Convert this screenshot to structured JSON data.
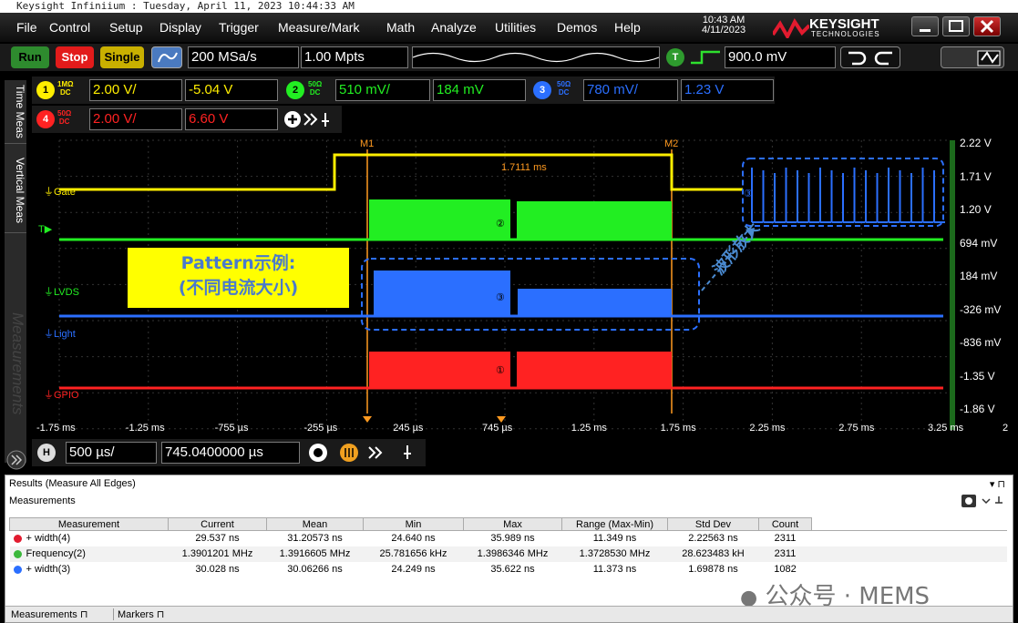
{
  "titlebar": "Keysight Infiniium : Tuesday, April 11, 2023 10:44:33 AM",
  "menu": [
    "File",
    "Control",
    "Setup",
    "Display",
    "Trigger",
    "Measure/Mark",
    "Math",
    "Analyze",
    "Utilities",
    "Demos",
    "Help"
  ],
  "clock": {
    "time": "10:43 AM",
    "date": "4/11/2023"
  },
  "brand": {
    "name": "KEYSIGHT",
    "sub": "TECHNOLOGIES"
  },
  "toolbar": {
    "run": "Run",
    "stop": "Stop",
    "single": "Single",
    "sample_rate": "200 MSa/s",
    "memory": "1.00 Mpts",
    "trigger_badge": "T",
    "trigger_level": "900.0 mV"
  },
  "channels": [
    {
      "num": "1",
      "tag1": "1MΩ",
      "tag2": "DC",
      "scale": "2.00 V/",
      "offset": "-5.04 V",
      "color": "#ffee00"
    },
    {
      "num": "2",
      "tag1": "50Ω",
      "tag2": "DC",
      "scale": "510 mV/",
      "offset": "184 mV",
      "color": "#22ee22"
    },
    {
      "num": "3",
      "tag1": "50Ω",
      "tag2": "DC",
      "scale": "780 mV/",
      "offset": "1.23 V",
      "color": "#2b6fff"
    },
    {
      "num": "4",
      "tag1": "50Ω",
      "tag2": "DC",
      "scale": "2.00 V/",
      "offset": "6.60 V",
      "color": "#ff2222"
    }
  ],
  "sidetabs": [
    "Time Meas",
    "Vertical Meas"
  ],
  "watermark": "Measurements",
  "markers": {
    "m1": "M1",
    "m2": "M2",
    "delta": "1.7111 ms"
  },
  "trace_labels": {
    "gate": "Gate",
    "lvds": "LVDS",
    "light": "Light",
    "gpio": "GPIO",
    "trig": "T"
  },
  "channel_markers": [
    "②",
    "③",
    "①",
    "③"
  ],
  "annotation": {
    "line1": "Pattern示例:",
    "line2": "(不同电流大小)",
    "zoom_label": "波形放大"
  },
  "x_ticks": [
    "-1.75 ms",
    "-1.25 ms",
    "-755 µs",
    "-255 µs",
    "245 µs",
    "745 µs",
    "1.25 ms",
    "1.75 ms",
    "2.25 ms",
    "2.75 ms",
    "3.25 ms"
  ],
  "x_end": "2",
  "y_ticks": [
    "2.22 V",
    "1.71 V",
    "1.20 V",
    "694 mV",
    "184 mV",
    "-326 mV",
    "-836 mV",
    "-1.35 V",
    "-1.86 V"
  ],
  "horizontal": {
    "badge": "H",
    "scale": "500 µs/",
    "position": "745.0400000 µs"
  },
  "results": {
    "title": "Results  (Measure All Edges)",
    "subtitle": "Measurements",
    "headers": [
      "Measurement",
      "Current",
      "Mean",
      "Min",
      "Max",
      "Range (Max-Min)",
      "Std Dev",
      "Count"
    ],
    "rows": [
      {
        "color": "#e21b2f",
        "cells": [
          "+ width(4)",
          "29.537 ns",
          "31.20573 ns",
          "24.640 ns",
          "35.989 ns",
          "11.349 ns",
          "2.22563 ns",
          "2311"
        ]
      },
      {
        "color": "#3cb83c",
        "cells": [
          "Frequency(2)",
          "1.3901201 MHz",
          "1.3916605 MHz",
          "25.781656 kHz",
          "1.3986346 MHz",
          "1.3728530 MHz",
          "28.623483 kH",
          "2311"
        ]
      },
      {
        "color": "#2b6fff",
        "cells": [
          "+ width(3)",
          "30.028 ns",
          "30.06266 ns",
          "24.249 ns",
          "35.622 ns",
          "11.373 ns",
          "1.69878 ns",
          "1082"
        ]
      }
    ],
    "tabs": [
      "Measurements",
      "Markers"
    ],
    "wechat": "公众号 · MEMS"
  }
}
